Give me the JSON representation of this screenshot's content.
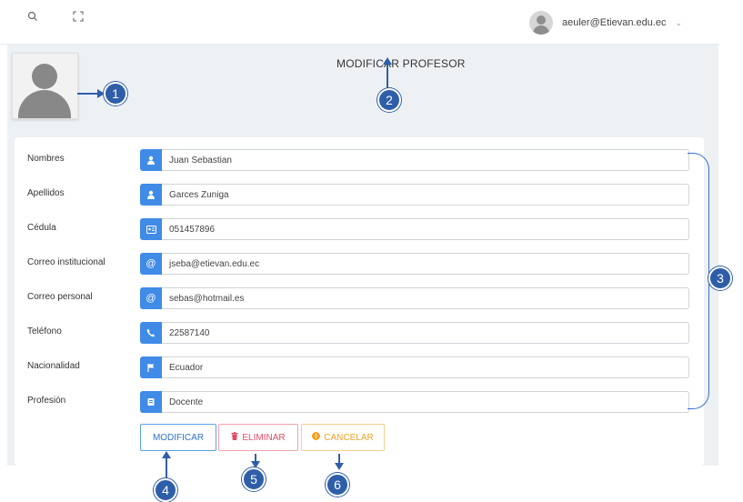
{
  "header": {
    "search_icon": "search-icon",
    "fullscreen_icon": "fullscreen-icon",
    "user_email": "aeuler@Etievan.edu.ec",
    "caret": "⌄"
  },
  "page_title": "MODIFICAR PROFESOR",
  "form": {
    "fields": [
      {
        "label": "Nombres",
        "value": "Juan Sebastian",
        "icon": "user-icon",
        "glyph": "👤"
      },
      {
        "label": "Apellidos",
        "value": "Garces Zuniga",
        "icon": "user-icon",
        "glyph": "👤"
      },
      {
        "label": "Cédula",
        "value": "051457896",
        "icon": "id-card-icon",
        "glyph": "🪪"
      },
      {
        "label": "Correo institucional",
        "value": "jseba@etievan.edu.ec",
        "icon": "at-icon",
        "glyph": "@"
      },
      {
        "label": "Correo personal",
        "value": "sebas@hotmail.es",
        "icon": "at-icon",
        "glyph": "@"
      },
      {
        "label": "Teléfono",
        "value": "22587140",
        "icon": "phone-icon",
        "glyph": "✆"
      },
      {
        "label": "Nacionalidad",
        "value": "Ecuador",
        "icon": "flag-icon",
        "glyph": "⚑"
      },
      {
        "label": "Profesión",
        "value": "Docente",
        "icon": "book-icon",
        "glyph": "▤"
      }
    ]
  },
  "buttons": {
    "modify": "MODIFICAR",
    "delete": "ELIMINAR",
    "delete_icon": "trash-icon",
    "cancel": "CANCELAR",
    "cancel_icon": "alert-circle-icon"
  },
  "annotations": [
    "1",
    "2",
    "3",
    "4",
    "5",
    "6"
  ],
  "colors": {
    "accent": "#3f8be6",
    "annotation": "#2f5ea9",
    "delete": "#e44a64",
    "cancel": "#f0a321"
  }
}
